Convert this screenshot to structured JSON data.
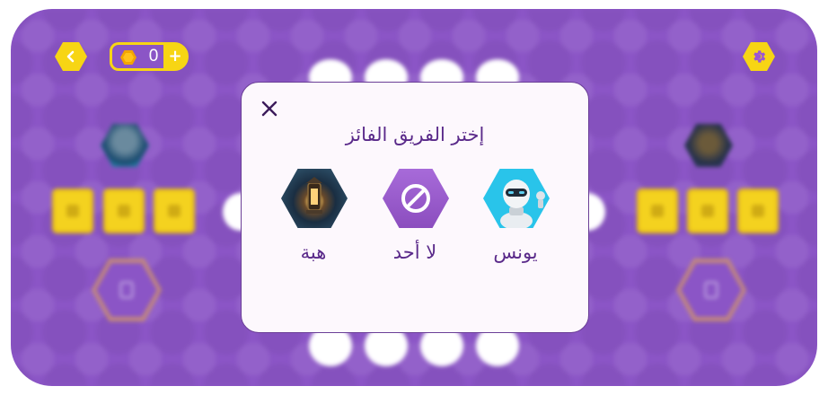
{
  "hud": {
    "coins": "0",
    "plus_label": "+"
  },
  "modal": {
    "title": "إختر الفريق الفائز",
    "options": [
      {
        "label": "هبة",
        "image": "lantern-avatar"
      },
      {
        "label": "لا أحد",
        "image": "no-entry-icon"
      },
      {
        "label": "يونس",
        "image": "robot-avatar"
      }
    ]
  },
  "colors": {
    "board": "#8b55c6",
    "accent_yellow": "#f7d514",
    "modal_text": "#5a2a8a",
    "none_button": "#9b56d4"
  }
}
